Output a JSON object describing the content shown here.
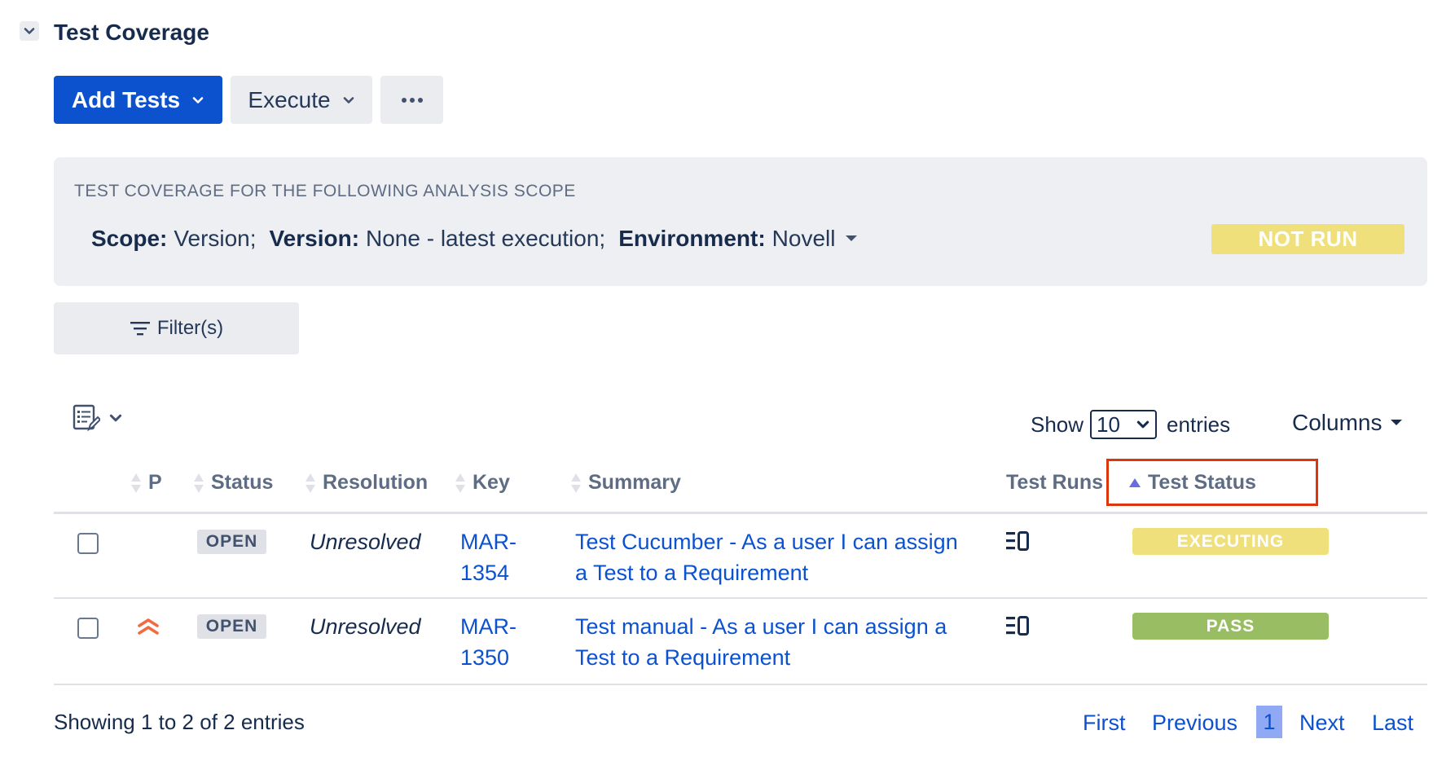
{
  "section": {
    "title": "Test Coverage"
  },
  "toolbar": {
    "add_tests_label": "Add Tests",
    "execute_label": "Execute",
    "more_label": "•••"
  },
  "scope": {
    "caption": "TEST COVERAGE FOR THE FOLLOWING ANALYSIS SCOPE",
    "scope_key": "Scope:",
    "scope_value": "Version;",
    "version_key": "Version:",
    "version_value": "None - latest execution;",
    "environment_key": "Environment:",
    "environment_value": "Novell",
    "overall_status": "NOT RUN"
  },
  "filter": {
    "label": "Filter(s)"
  },
  "table_controls": {
    "show_label": "Show",
    "page_size": "10",
    "entries_label": "entries",
    "columns_label": "Columns"
  },
  "columns": {
    "priority": "P",
    "status": "Status",
    "resolution": "Resolution",
    "key": "Key",
    "summary": "Summary",
    "test_runs": "Test Runs",
    "test_status": "Test Status"
  },
  "rows": [
    {
      "status": "OPEN",
      "resolution": "Unresolved",
      "key_line1": "MAR-",
      "key_line2": "1354",
      "summary_line1": "Test Cucumber - As a user I can assign",
      "summary_line2": "a Test to a Requirement",
      "test_status": "EXECUTING",
      "test_status_color": "#efe07b",
      "priority": ""
    },
    {
      "status": "OPEN",
      "resolution": "Unresolved",
      "key_line1": "MAR-",
      "key_line2": "1350",
      "summary_line1": "Test manual - As a user I can assign a",
      "summary_line2": "Test to a Requirement",
      "test_status": "PASS",
      "test_status_color": "#99bd62",
      "priority": "highest-priority-icon"
    }
  ],
  "footer": {
    "showing": "Showing 1 to 2 of 2 entries",
    "first": "First",
    "previous": "Previous",
    "current_page": "1",
    "next": "Next",
    "last": "Last"
  },
  "colors": {
    "primary": "#0c52cf",
    "highlight_border": "#de350b",
    "priority_icon": "#f06b3f"
  }
}
